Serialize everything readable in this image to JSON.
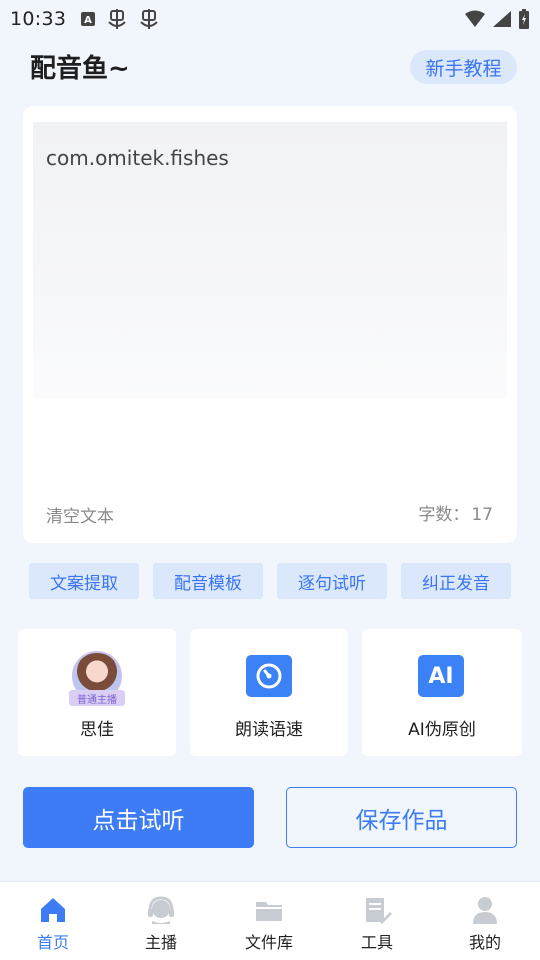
{
  "status_bar": {
    "time": "10:33",
    "left_icons": [
      "a-badge-icon",
      "bug-icon",
      "bug-icon"
    ],
    "right_icons": [
      "wifi-icon",
      "signal-icon",
      "battery-icon"
    ]
  },
  "header": {
    "title": "配音鱼~",
    "tutorial_label": "新手教程"
  },
  "editor": {
    "text": "com.omitek.fishes",
    "clear_label": "清空文本",
    "count_label": "字数：",
    "count_value": "17"
  },
  "chips": [
    {
      "label": "文案提取"
    },
    {
      "label": "配音模板"
    },
    {
      "label": "逐句试听"
    },
    {
      "label": "纠正发音"
    }
  ],
  "features": {
    "voice": {
      "label": "思佳",
      "badge": "普通主播"
    },
    "speed": {
      "label": "朗读语速"
    },
    "ai": {
      "label": "AI伪原创",
      "icon_text": "AI"
    }
  },
  "actions": {
    "listen_label": "点击试听",
    "save_label": "保存作品"
  },
  "bottom_nav": [
    {
      "label": "首页",
      "icon": "home-icon"
    },
    {
      "label": "主播",
      "icon": "headset-icon"
    },
    {
      "label": "文件库",
      "icon": "folder-icon"
    },
    {
      "label": "工具",
      "icon": "tools-icon"
    },
    {
      "label": "我的",
      "icon": "user-icon"
    }
  ],
  "colors": {
    "accent": "#3d7cf5",
    "chip_bg": "#dbe7fb",
    "page_bg": "#f1f5fc"
  }
}
